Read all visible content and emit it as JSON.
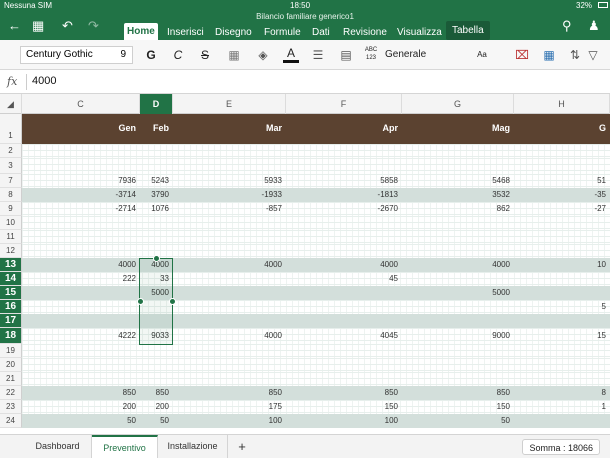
{
  "status": {
    "carrier": "Nessuna SIM",
    "time": "18:50",
    "battery": "32%"
  },
  "app": {
    "filename": "Bilancio familiare generico1"
  },
  "ribbon": {
    "tabs": [
      "Home",
      "Inserisci",
      "Disegno",
      "Formule",
      "Dati",
      "Revisione",
      "Visualizza",
      "Tabella"
    ],
    "active": "Home"
  },
  "toolbar": {
    "font_name": "Century Gothic",
    "font_size": "9",
    "bold": "G",
    "italic": "C",
    "strike": "S",
    "text_color_glyph": "A",
    "format": "Generale",
    "abc_label": "ABC 123",
    "aa": "Aa"
  },
  "formula": {
    "fx": "fx",
    "value": "4000"
  },
  "columns": [
    "C",
    "D",
    "E",
    "F",
    "G",
    "H"
  ],
  "selected_column": "D",
  "header_row": {
    "row_number": "1",
    "cells": [
      "Gen",
      "Feb",
      "Mar",
      "Apr",
      "Mag",
      "G"
    ]
  },
  "rows": [
    {
      "n": "2",
      "cells": [
        "",
        "",
        "",
        "",
        "",
        ""
      ]
    },
    {
      "n": "3",
      "cells": [
        "",
        "",
        "",
        "",
        "",
        ""
      ]
    },
    {
      "n": "7",
      "cells": [
        "7936",
        "5243",
        "5933",
        "5858",
        "5468",
        "51"
      ]
    },
    {
      "n": "8",
      "cells": [
        "-3714",
        "3790",
        "-1933",
        "-1813",
        "3532",
        "-35"
      ]
    },
    {
      "n": "9",
      "cells": [
        "-2714",
        "1076",
        "-857",
        "-2670",
        "862",
        "-27"
      ]
    },
    {
      "n": "10",
      "cells": [
        "",
        "",
        "",
        "",
        "",
        ""
      ]
    },
    {
      "n": "11",
      "cells": [
        "",
        "",
        "",
        "",
        "",
        ""
      ]
    },
    {
      "n": "12",
      "cells": [
        "",
        "",
        "",
        "",
        "",
        ""
      ]
    },
    {
      "n": "13",
      "cells": [
        "4000",
        "4000",
        "4000",
        "4000",
        "4000",
        "10"
      ]
    },
    {
      "n": "14",
      "cells": [
        "222",
        "33",
        "",
        "45",
        "",
        ""
      ]
    },
    {
      "n": "15",
      "cells": [
        "",
        "5000",
        "",
        "",
        "5000",
        ""
      ]
    },
    {
      "n": "16",
      "cells": [
        "",
        "",
        "",
        "",
        "",
        "5"
      ]
    },
    {
      "n": "17",
      "cells": [
        "",
        "",
        "",
        "",
        "",
        ""
      ]
    },
    {
      "n": "18",
      "cells": [
        "4222",
        "9033",
        "4000",
        "4045",
        "9000",
        "15"
      ]
    },
    {
      "n": "19",
      "cells": [
        "",
        "",
        "",
        "",
        "",
        ""
      ]
    },
    {
      "n": "20",
      "cells": [
        "",
        "",
        "",
        "",
        "",
        ""
      ]
    },
    {
      "n": "21",
      "cells": [
        "",
        "",
        "",
        "",
        "",
        ""
      ]
    },
    {
      "n": "22",
      "cells": [
        "850",
        "850",
        "850",
        "850",
        "850",
        "8"
      ]
    },
    {
      "n": "23",
      "cells": [
        "200",
        "200",
        "175",
        "150",
        "150",
        "1"
      ]
    },
    {
      "n": "24",
      "cells": [
        "50",
        "50",
        "100",
        "100",
        "50",
        ""
      ]
    }
  ],
  "sheets": [
    "Dashboard",
    "Preventivo",
    "Installazione"
  ],
  "active_sheet": "Preventivo",
  "add_sheet": "+",
  "sum": "Somma : 18066"
}
